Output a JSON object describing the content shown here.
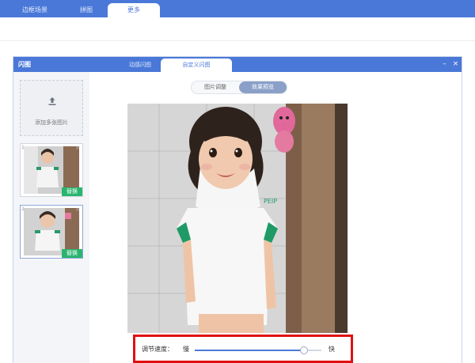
{
  "app": {
    "tabs": [
      {
        "label": "边框场景"
      },
      {
        "label": "拼图"
      },
      {
        "label": "更多",
        "active": true
      }
    ]
  },
  "dialog": {
    "logo": "闪图",
    "tabs": [
      {
        "label": "动感闪图"
      },
      {
        "label": "自定义闪图",
        "active": true
      }
    ],
    "controls": {
      "minimize": "–",
      "close": "×"
    }
  },
  "left_panel": {
    "add_label": "添加多张图片",
    "thumbnails": [
      {
        "index": "1",
        "replace_label": "替换",
        "close": "×"
      },
      {
        "index": "2",
        "replace_label": "替换",
        "close": "×",
        "selected": true
      }
    ]
  },
  "work_area": {
    "modes": [
      {
        "label": "图片调整"
      },
      {
        "label": "效果预览",
        "active": true
      }
    ],
    "preview_text": "PEIP",
    "speed": {
      "label": "调节速度：",
      "slow": "慢",
      "fast": "快",
      "value": 0.86
    }
  },
  "colors": {
    "accent": "#4a78d8",
    "replace_badge": "#29b56f",
    "highlight_box": "#e01010"
  }
}
